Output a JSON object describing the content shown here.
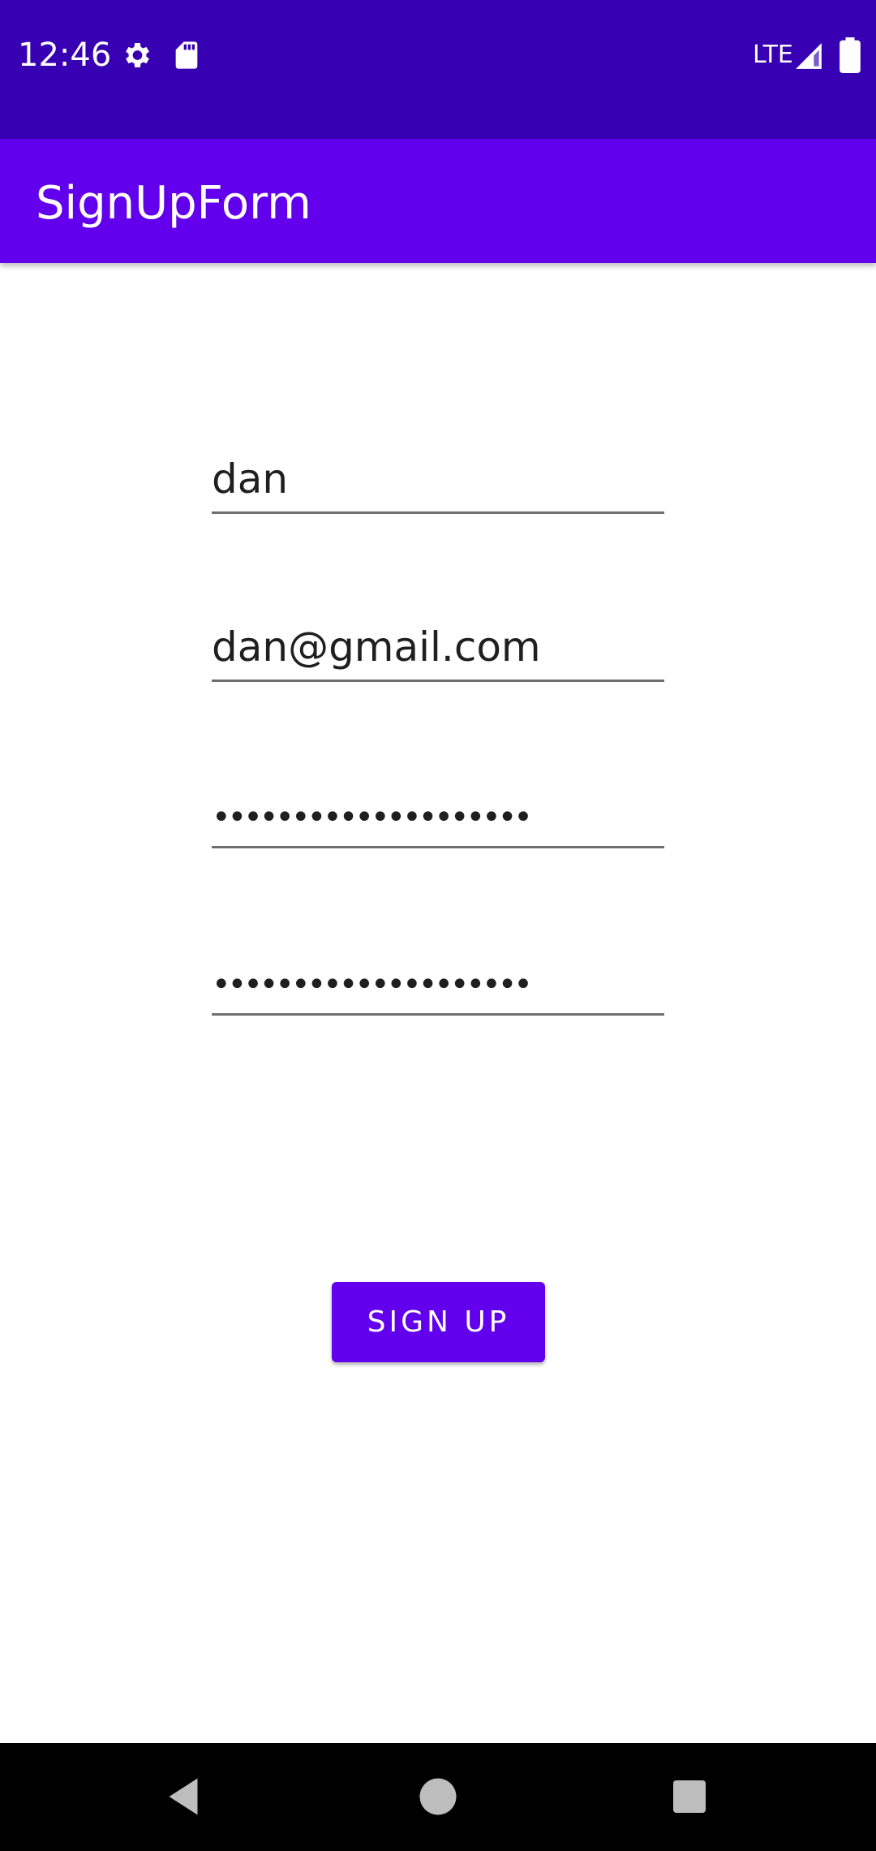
{
  "status_bar": {
    "time": "12:46",
    "icons": [
      "settings-icon",
      "sd-card-icon",
      "signal-icon",
      "battery-icon"
    ],
    "network": "LTE",
    "background_color": "#3700B3"
  },
  "app_bar": {
    "title": "SignUpForm",
    "background_color": "#6200EE"
  },
  "form": {
    "name_value": "dan",
    "email_value": "dan@gmail.com",
    "password_value": "••••••••••••••••••••",
    "confirm_password_value": "••••••••••••••••••••",
    "submit_label": "SIGN UP"
  },
  "nav_bar": {
    "icons": [
      "back-icon",
      "home-icon",
      "recents-icon"
    ]
  }
}
